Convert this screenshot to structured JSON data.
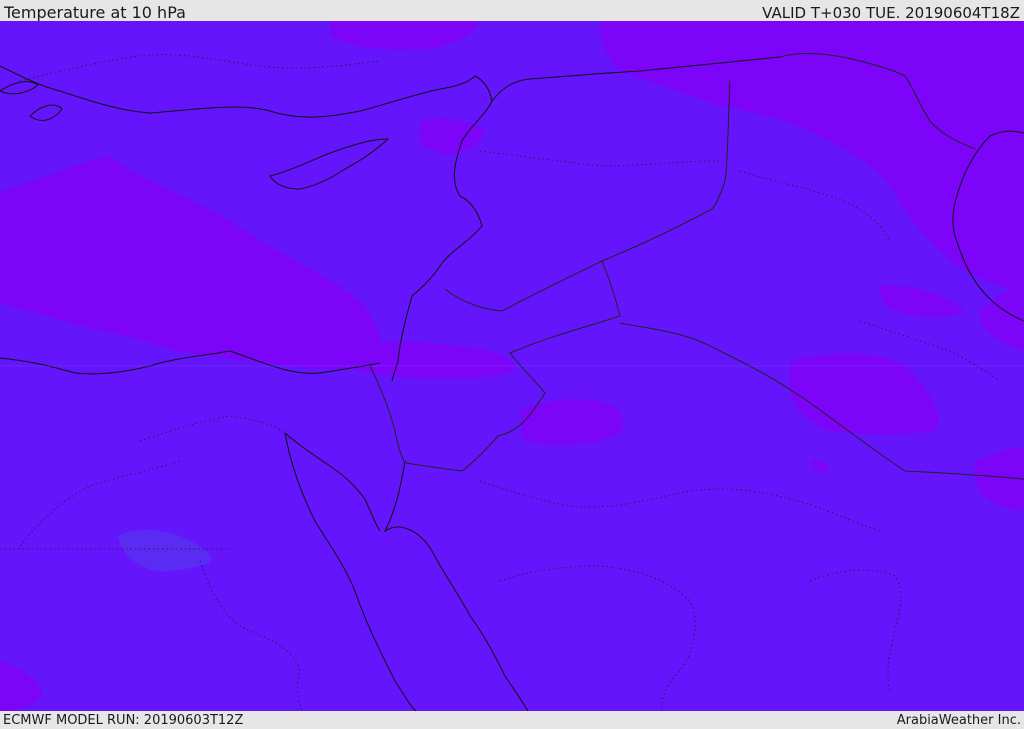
{
  "header": {
    "title": "Temperature at 10 hPa",
    "valid": "VALID T+030 TUE. 20190604T18Z"
  },
  "footer": {
    "model_run": "ECMWF MODEL RUN: 20190603T12Z",
    "credit": "ArabiaWeather Inc."
  },
  "map": {
    "region": "Eastern Mediterranean / Middle East",
    "colors": {
      "base_field": "#6515fb",
      "warm_field": "#7c04f8",
      "cool_field": "#5a2cf3",
      "coastline": "#111111",
      "border": "#222222"
    }
  }
}
